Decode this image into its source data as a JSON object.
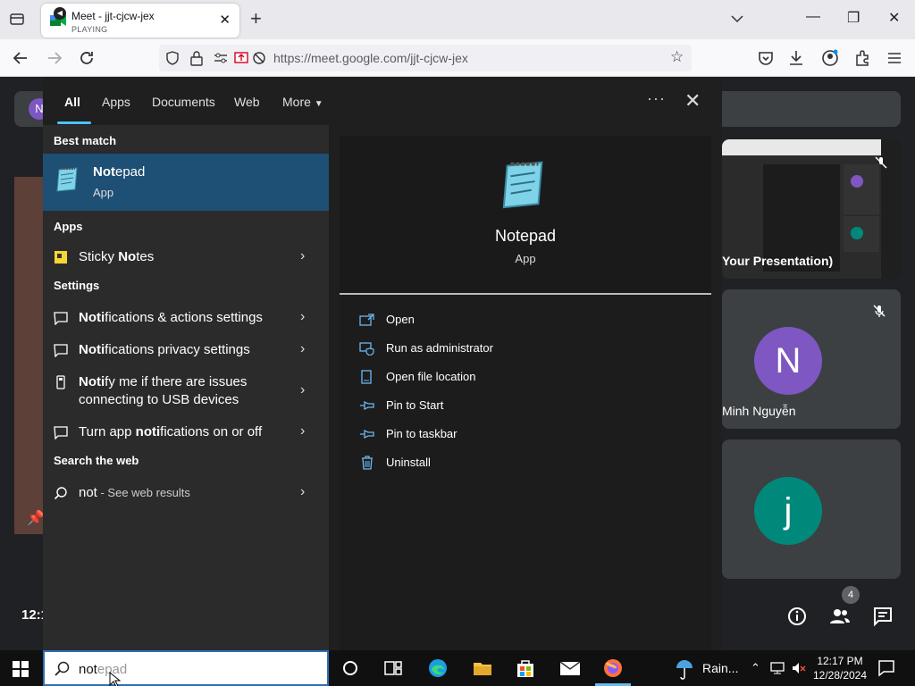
{
  "browser": {
    "tab": {
      "title": "Meet - jjt-cjcw-jex",
      "status": "PLAYING"
    },
    "url": "https://meet.google.com/jjt-cjcw-jex"
  },
  "meet": {
    "avatar_letter": "N",
    "left_time": "12:1",
    "tiles": [
      {
        "caption": "Your Presentation)"
      },
      {
        "letter": "N",
        "name": "Minh Nguyễn",
        "color": "#7e57c2"
      },
      {
        "letter": "j",
        "color": "#00897b"
      }
    ],
    "people_count": "4"
  },
  "search_panel": {
    "tabs": [
      "All",
      "Apps",
      "Documents",
      "Web",
      "More"
    ],
    "more_dots": "···",
    "best_match_header": "Best match",
    "best_match": {
      "name_bold": "Not",
      "name_rest": "epad",
      "type": "App"
    },
    "apps_header": "Apps",
    "apps": [
      {
        "pre": "Sticky ",
        "bold": "No",
        "post": "tes"
      }
    ],
    "settings_header": "Settings",
    "settings": [
      {
        "bold": "Noti",
        "post": "fications & actions settings"
      },
      {
        "bold": "Noti",
        "post": "fications privacy settings"
      },
      {
        "bold": "Noti",
        "post": "fy me if there are issues connecting to USB devices"
      },
      {
        "pre": "Turn app ",
        "bold": "noti",
        "post": "fications on or off"
      }
    ],
    "web_header": "Search the web",
    "web": {
      "query": "not",
      "suffix": " - See web results"
    },
    "detail": {
      "name": "Notepad",
      "type": "App",
      "actions": [
        "Open",
        "Run as administrator",
        "Open file location",
        "Pin to Start",
        "Pin to taskbar",
        "Uninstall"
      ]
    }
  },
  "taskbar": {
    "search": {
      "typed": "not",
      "ghost": "epad"
    },
    "weather": "Rain...",
    "time": "12:17 PM",
    "date": "12/28/2024"
  }
}
